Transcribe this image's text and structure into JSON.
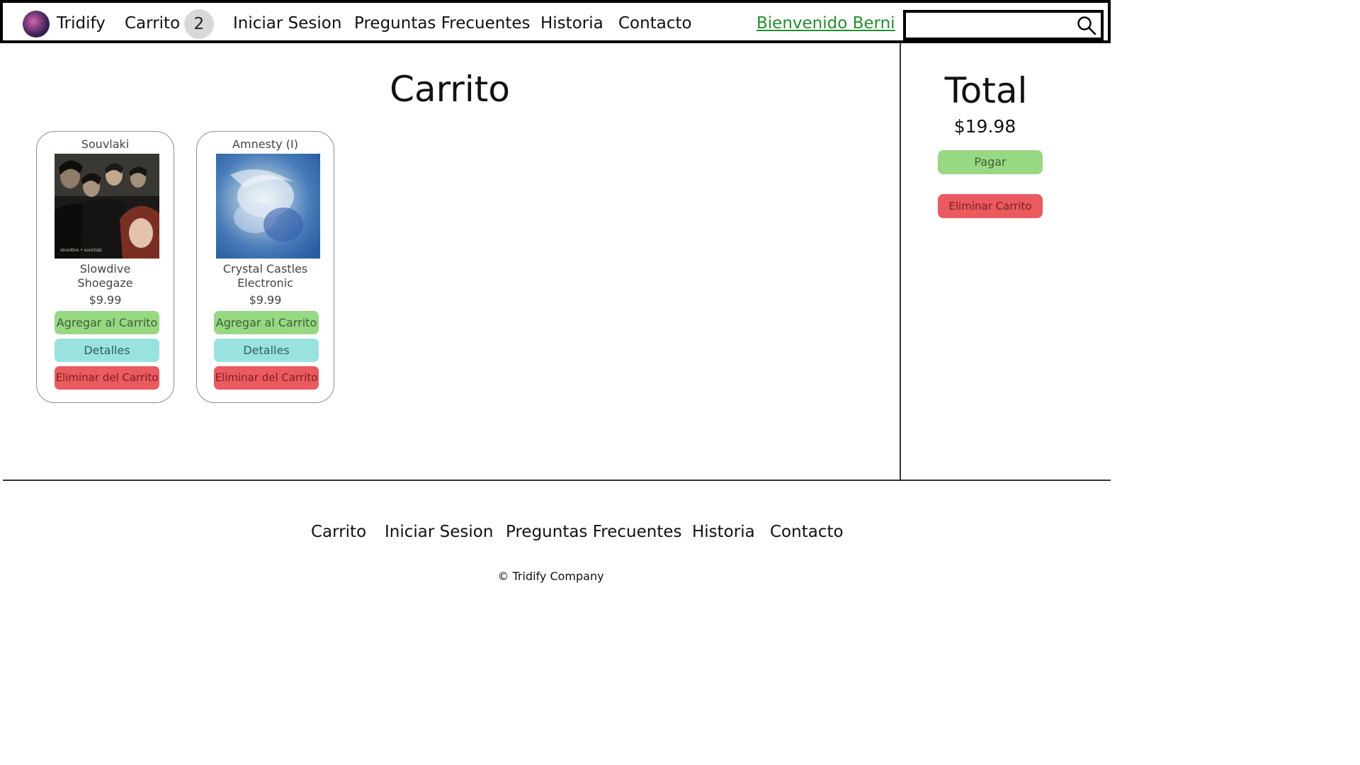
{
  "header": {
    "brand": "Tridify",
    "logo_icon": "galaxy-logo-icon",
    "nav": {
      "cart": "Carrito",
      "cart_count": "2",
      "login": "Iniciar Sesion",
      "faq": "Preguntas Frecuentes",
      "history": "Historia",
      "contact": "Contacto"
    },
    "welcome": "Bienvenido Berni",
    "search": {
      "value": "",
      "placeholder": "",
      "icon": "search-icon"
    }
  },
  "main": {
    "title": "Carrito",
    "products": [
      {
        "title": "Souvlaki",
        "artist": "Slowdive",
        "genre": "Shoegaze",
        "price": "$9.99",
        "cover_caption": "slowdive • souvlaki",
        "add_label": "Agregar al Carrito",
        "details_label": "Detalles",
        "remove_label": "Eliminar del Carrito"
      },
      {
        "title": "Amnesty (I)",
        "artist": "Crystal Castles",
        "genre": "Electronic",
        "price": "$9.99",
        "add_label": "Agregar al Carrito",
        "details_label": "Detalles",
        "remove_label": "Eliminar del Carrito"
      }
    ]
  },
  "sidebar": {
    "title": "Total",
    "total": "$19.98",
    "pay_label": "Pagar",
    "clear_label": "Eliminar Carrito"
  },
  "footer": {
    "links": {
      "cart": "Carrito",
      "login": "Iniciar Sesion",
      "faq": "Preguntas Frecuentes",
      "history": "Historia",
      "contact": "Contacto"
    },
    "copyright": "© Tridify Company"
  },
  "colors": {
    "welcome": "#1f8f2b",
    "add_button": "#97d883",
    "details_button": "#98e3dd",
    "remove_button": "#ea5a5e",
    "badge": "#d8d8d8"
  }
}
